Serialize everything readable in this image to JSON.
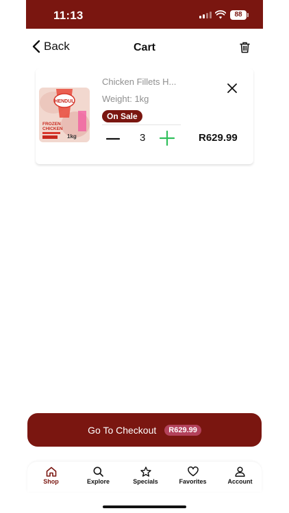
{
  "status_bar": {
    "time": "11:13",
    "battery": "88"
  },
  "nav": {
    "back_label": "Back",
    "title": "Cart"
  },
  "cart": {
    "items": [
      {
        "name": "Chicken Fillets H...",
        "weight": "Weight: 1kg",
        "badge": "On Sale",
        "quantity": "3",
        "price": "R629.99",
        "image_text": {
          "brand": "HENDUL",
          "line1": "FROZEN",
          "line2": "CHICKEN",
          "size": "1kg"
        }
      }
    ]
  },
  "checkout": {
    "label": "Go To Checkout",
    "total": "R629.99"
  },
  "tabs": [
    {
      "label": "Shop",
      "icon": "home-icon",
      "active": true
    },
    {
      "label": "Explore",
      "icon": "search-icon",
      "active": false
    },
    {
      "label": "Specials",
      "icon": "star-icon",
      "active": false
    },
    {
      "label": "Favorites",
      "icon": "heart-icon",
      "active": false
    },
    {
      "label": "Account",
      "icon": "user-icon",
      "active": false
    }
  ],
  "colors": {
    "brand": "#7a1610",
    "badge_pink": "#b3425b",
    "plus_green": "#2fbf5a",
    "muted_text": "#8f8f8f"
  }
}
